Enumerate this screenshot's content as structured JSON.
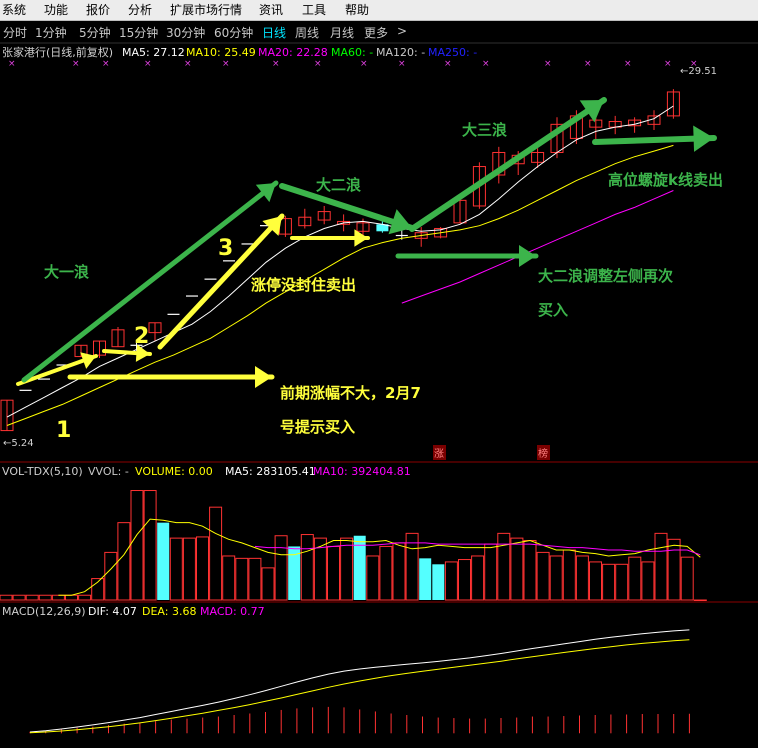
{
  "menu": {
    "items": [
      "系统",
      "功能",
      "报价",
      "分析",
      "扩展市场行情",
      "资讯",
      "工具",
      "帮助"
    ]
  },
  "periods": {
    "items": [
      "分时",
      "1分钟",
      "5分钟",
      "15分钟",
      "30分钟",
      "60分钟",
      "日线",
      "周线",
      "月线",
      "更多"
    ],
    "active": "日线",
    "more_arrow": ">"
  },
  "colors": {
    "up": "#ff3232",
    "down": "#54ffff",
    "flat": "#ffffff",
    "ma5": "#ffffff",
    "ma10": "#ffff00",
    "ma20": "#ff00ff",
    "ma60": "#00ff00",
    "ma120": "#c8c8c8",
    "ma250": "#2222ff",
    "annotation_yellow": "#ffff3c",
    "annotation_green": "#3cb44b",
    "grid": "#8c0000"
  },
  "price_panel": {
    "title": "张家港行(日线,前复权)",
    "ma_labels": [
      {
        "text": "MA5: 27.12",
        "color": "#ffffff"
      },
      {
        "text": "MA10: 25.49",
        "color": "#ffff00"
      },
      {
        "text": "MA20: 22.28",
        "color": "#ff00ff"
      },
      {
        "text": "MA60: -",
        "color": "#00ff00"
      },
      {
        "text": "MA120: -",
        "color": "#c8c8c8"
      },
      {
        "text": "MA250: -",
        "color": "#2222ff"
      }
    ],
    "high_label": "29.51",
    "low_label": "5.24",
    "tags": [
      "涨",
      "榜"
    ]
  },
  "annotations": {
    "wave1": "大一浪",
    "wave2": "大二浪",
    "wave3": "大三浪",
    "stop_note": "涨停没封住卖出",
    "early_note_line1": "前期涨幅不大，2月7",
    "early_note_line2": "号提示买入",
    "rebuy_line1": "大二浪调整左侧再次",
    "rebuy_line2": "买入",
    "spiral_note": "高位螺旋k线卖出",
    "hand_marks": [
      "1",
      "2",
      "3"
    ]
  },
  "vol_panel": {
    "title": "VOL-TDX(5,10)",
    "labels": [
      {
        "text": "VVOL: -",
        "color": "#c8c8c8"
      },
      {
        "text": "VOLUME: 0.00",
        "color": "#ffff00"
      },
      {
        "text": "MA5: 283105.41",
        "color": "#ffffff"
      },
      {
        "text": "MA10: 392404.81",
        "color": "#ff00ff"
      }
    ]
  },
  "macd_panel": {
    "title": "MACD(12,26,9)",
    "labels": [
      {
        "text": "DIF: 4.07",
        "color": "#ffffff"
      },
      {
        "text": "DEA: 3.68",
        "color": "#ffff00"
      },
      {
        "text": "MACD: 0.77",
        "color": "#ff00ff"
      }
    ]
  },
  "chart_data": {
    "type": "candlestick",
    "y_range": [
      4.5,
      31.5
    ],
    "candles": [
      {
        "o": 5.24,
        "h": 7.4,
        "l": 5.24,
        "c": 7.4,
        "kind": "up"
      },
      {
        "o": 8.1,
        "h": 8.1,
        "l": 8.1,
        "c": 8.1,
        "kind": "flat"
      },
      {
        "o": 8.9,
        "h": 8.9,
        "l": 8.9,
        "c": 8.9,
        "kind": "flat"
      },
      {
        "o": 9.9,
        "h": 9.9,
        "l": 9.9,
        "c": 9.9,
        "kind": "flat"
      },
      {
        "o": 10.5,
        "h": 11.3,
        "l": 10.5,
        "c": 11.3,
        "kind": "up"
      },
      {
        "o": 10.6,
        "h": 11.6,
        "l": 10.4,
        "c": 11.6,
        "kind": "up"
      },
      {
        "o": 11.2,
        "h": 12.6,
        "l": 11.2,
        "c": 12.4,
        "kind": "up"
      },
      {
        "o": 11.3,
        "h": 11.6,
        "l": 10.9,
        "c": 11.3,
        "kind": "flat"
      },
      {
        "o": 12.2,
        "h": 12.9,
        "l": 11.6,
        "c": 12.9,
        "kind": "up"
      },
      {
        "o": 13.5,
        "h": 13.5,
        "l": 13.5,
        "c": 13.5,
        "kind": "flat"
      },
      {
        "o": 14.8,
        "h": 14.8,
        "l": 14.8,
        "c": 14.8,
        "kind": "flat"
      },
      {
        "o": 16.0,
        "h": 16.0,
        "l": 16.0,
        "c": 16.0,
        "kind": "flat"
      },
      {
        "o": 17.3,
        "h": 17.3,
        "l": 17.3,
        "c": 17.3,
        "kind": "flat"
      },
      {
        "o": 18.5,
        "h": 18.5,
        "l": 18.5,
        "c": 18.5,
        "kind": "flat"
      },
      {
        "o": 19.8,
        "h": 19.8,
        "l": 19.8,
        "c": 19.8,
        "kind": "flat"
      },
      {
        "o": 19.2,
        "h": 20.5,
        "l": 19.0,
        "c": 20.3,
        "kind": "up"
      },
      {
        "o": 19.8,
        "h": 21.0,
        "l": 19.6,
        "c": 20.4,
        "kind": "up"
      },
      {
        "o": 20.2,
        "h": 21.2,
        "l": 19.9,
        "c": 20.8,
        "kind": "up"
      },
      {
        "o": 19.9,
        "h": 20.6,
        "l": 19.4,
        "c": 20.1,
        "kind": "up"
      },
      {
        "o": 19.4,
        "h": 20.3,
        "l": 19.1,
        "c": 20.0,
        "kind": "up"
      },
      {
        "o": 19.9,
        "h": 20.2,
        "l": 19.3,
        "c": 19.4,
        "kind": "down"
      },
      {
        "o": 19.1,
        "h": 19.6,
        "l": 18.8,
        "c": 19.1,
        "kind": "flat"
      },
      {
        "o": 18.9,
        "h": 19.7,
        "l": 18.3,
        "c": 19.3,
        "kind": "up"
      },
      {
        "o": 19.0,
        "h": 19.7,
        "l": 18.9,
        "c": 19.6,
        "kind": "up"
      },
      {
        "o": 20.0,
        "h": 21.8,
        "l": 20.0,
        "c": 21.6,
        "kind": "up"
      },
      {
        "o": 21.2,
        "h": 24.3,
        "l": 21.0,
        "c": 24.0,
        "kind": "up"
      },
      {
        "o": 23.4,
        "h": 25.4,
        "l": 22.8,
        "c": 25.0,
        "kind": "up"
      },
      {
        "o": 24.2,
        "h": 25.1,
        "l": 23.4,
        "c": 24.8,
        "kind": "up"
      },
      {
        "o": 24.3,
        "h": 25.3,
        "l": 23.9,
        "c": 25.0,
        "kind": "up"
      },
      {
        "o": 25.0,
        "h": 27.5,
        "l": 24.6,
        "c": 27.0,
        "kind": "up"
      },
      {
        "o": 26.0,
        "h": 28.0,
        "l": 25.6,
        "c": 27.6,
        "kind": "up"
      },
      {
        "o": 26.8,
        "h": 27.8,
        "l": 25.6,
        "c": 27.3,
        "kind": "up"
      },
      {
        "o": 26.8,
        "h": 27.6,
        "l": 26.3,
        "c": 27.2,
        "kind": "up"
      },
      {
        "o": 26.9,
        "h": 27.5,
        "l": 26.4,
        "c": 27.3,
        "kind": "up"
      },
      {
        "o": 27.0,
        "h": 28.0,
        "l": 26.6,
        "c": 27.6,
        "kind": "up"
      },
      {
        "o": 27.6,
        "h": 29.5,
        "l": 27.4,
        "c": 29.3,
        "kind": "up"
      }
    ],
    "ma5": [
      6.2,
      6.9,
      7.6,
      8.3,
      9.0,
      9.8,
      10.4,
      11.0,
      11.6,
      12.2,
      12.8,
      13.7,
      14.8,
      16.0,
      17.2,
      18.2,
      19.0,
      19.6,
      20.0,
      20.1,
      19.9,
      19.6,
      19.4,
      19.5,
      19.9,
      20.6,
      21.7,
      22.9,
      24.0,
      25.0,
      25.9,
      26.5,
      26.8,
      27.0,
      27.4,
      28.3
    ],
    "ma10": [
      5.6,
      6.1,
      6.6,
      7.1,
      7.7,
      8.3,
      8.9,
      9.5,
      10.1,
      10.6,
      11.2,
      11.8,
      12.6,
      13.4,
      14.3,
      15.1,
      15.9,
      16.7,
      17.5,
      18.2,
      18.6,
      18.9,
      19.1,
      19.3,
      19.5,
      19.8,
      20.3,
      20.9,
      21.6,
      22.3,
      23.0,
      23.6,
      24.2,
      24.7,
      25.1,
      25.5
    ],
    "ma20": [
      null,
      null,
      null,
      null,
      null,
      null,
      null,
      null,
      null,
      null,
      null,
      null,
      null,
      null,
      null,
      null,
      null,
      null,
      null,
      null,
      null,
      14.3,
      14.8,
      15.3,
      15.8,
      16.4,
      17.0,
      17.6,
      18.2,
      18.8,
      19.4,
      20.0,
      20.6,
      21.1,
      21.7,
      22.3
    ],
    "volume": {
      "y_range": [
        0,
        100
      ],
      "bars": [
        4,
        4,
        4,
        4,
        4,
        4,
        4,
        18,
        40,
        65,
        92,
        92,
        65,
        52,
        52,
        53,
        78,
        37,
        35,
        35,
        27,
        54,
        45,
        55,
        52,
        45,
        52,
        54,
        37,
        45,
        48,
        56,
        35,
        30,
        32,
        34,
        37,
        47,
        56,
        52,
        50,
        40,
        37,
        42,
        37,
        32,
        30,
        30,
        36,
        32,
        56,
        51,
        36,
        0
      ],
      "kinds": [
        "up",
        "up",
        "up",
        "up",
        "up",
        "up",
        "up",
        "up",
        "up",
        "up",
        "up",
        "up",
        "down",
        "up",
        "up",
        "up",
        "up",
        "up",
        "up",
        "up",
        "up",
        "up",
        "down",
        "up",
        "up",
        "up",
        "up",
        "down",
        "up",
        "up",
        "up",
        "up",
        "down",
        "down",
        "up",
        "up",
        "up",
        "up",
        "up",
        "up",
        "up",
        "up",
        "up",
        "up",
        "up",
        "up",
        "up",
        "up",
        "up",
        "up",
        "up",
        "up",
        "up",
        "up"
      ],
      "ma5": [
        null,
        null,
        null,
        null,
        4,
        4,
        7,
        15,
        26,
        38,
        55,
        68,
        67,
        65,
        65,
        62,
        56,
        51,
        48,
        44,
        40,
        38,
        38,
        41,
        45,
        50,
        50,
        49,
        49,
        50,
        46,
        43,
        44,
        46,
        45,
        44,
        44,
        44,
        46,
        48,
        50,
        46,
        42,
        42,
        40,
        39,
        37,
        38,
        39,
        42,
        44,
        46,
        45,
        36
      ],
      "ma10": [
        null,
        null,
        null,
        null,
        null,
        null,
        null,
        null,
        null,
        null,
        null,
        null,
        null,
        null,
        null,
        null,
        null,
        null,
        null,
        45,
        44,
        44,
        43,
        43,
        44,
        45,
        46,
        46,
        46,
        47,
        48,
        48,
        48,
        47,
        47,
        47,
        47,
        47,
        47,
        47,
        47,
        46,
        45,
        44,
        44,
        43,
        42,
        42,
        41,
        41,
        41,
        42,
        42,
        38
      ]
    },
    "macd": {
      "y_range": [
        -0.5,
        4.5
      ],
      "dif": [
        0.05,
        0.1,
        0.17,
        0.25,
        0.33,
        0.42,
        0.52,
        0.62,
        0.74,
        0.86,
        0.98,
        1.1,
        1.23,
        1.37,
        1.52,
        1.68,
        1.85,
        2.02,
        2.18,
        2.33,
        2.45,
        2.53,
        2.6,
        2.66,
        2.72,
        2.77,
        2.83,
        2.9,
        2.97,
        3.05,
        3.14,
        3.24,
        3.34,
        3.43,
        3.52,
        3.61,
        3.7,
        3.78,
        3.85,
        3.92,
        3.98,
        4.03,
        4.07
      ],
      "dea": [
        0.02,
        0.05,
        0.09,
        0.14,
        0.2,
        0.26,
        0.33,
        0.41,
        0.5,
        0.59,
        0.69,
        0.79,
        0.9,
        1.01,
        1.13,
        1.26,
        1.39,
        1.53,
        1.67,
        1.81,
        1.94,
        2.06,
        2.17,
        2.27,
        2.36,
        2.44,
        2.52,
        2.6,
        2.68,
        2.76,
        2.84,
        2.93,
        3.01,
        3.1,
        3.18,
        3.26,
        3.34,
        3.41,
        3.48,
        3.54,
        3.59,
        3.64,
        3.68
      ],
      "macd": [
        0.06,
        0.1,
        0.16,
        0.22,
        0.26,
        0.32,
        0.38,
        0.42,
        0.48,
        0.54,
        0.58,
        0.62,
        0.66,
        0.72,
        0.78,
        0.84,
        0.92,
        0.98,
        1.02,
        1.04,
        1.02,
        0.94,
        0.86,
        0.78,
        0.72,
        0.66,
        0.62,
        0.6,
        0.58,
        0.58,
        0.6,
        0.62,
        0.66,
        0.66,
        0.68,
        0.7,
        0.72,
        0.74,
        0.74,
        0.76,
        0.76,
        0.76,
        0.77
      ]
    }
  }
}
